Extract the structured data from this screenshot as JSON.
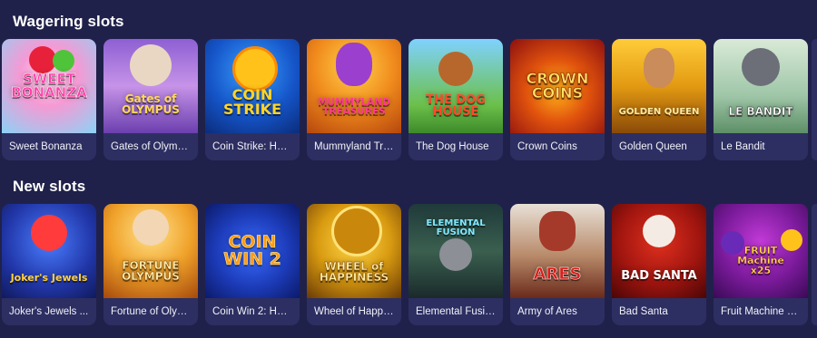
{
  "sections": [
    {
      "title": "Wagering slots",
      "games": [
        {
          "name": "Sweet Bonanza",
          "art": "SWEET\nBONANZA"
        },
        {
          "name": "Gates of Olymp...",
          "art": "Gates of\nOLYMPUS"
        },
        {
          "name": "Coin Strike: Hol...",
          "art": "COIN\nSTRIKE"
        },
        {
          "name": "Mummyland Tre...",
          "art": "MUMMYLAND\nTREASURES"
        },
        {
          "name": "The Dog House",
          "art": "THE DOG\nHOUSE"
        },
        {
          "name": "Crown Coins",
          "art": "CROWN\nCOINS"
        },
        {
          "name": "Golden Queen",
          "art": "GOLDEN QUEEN"
        },
        {
          "name": "Le Bandit",
          "art": "LE BANDIT"
        }
      ]
    },
    {
      "title": "New slots",
      "games": [
        {
          "name": "Joker's Jewels ...",
          "art": "Joker's Jewels"
        },
        {
          "name": "Fortune of Olym...",
          "art": "FORTUNE\nOLYMPUS"
        },
        {
          "name": "Coin Win 2: Hol...",
          "art": "COIN\nWIN 2"
        },
        {
          "name": "Wheel of Happi...",
          "art": "WHEEL of\nHAPPINESS"
        },
        {
          "name": "Elemental Fusion",
          "art": "ELEMENTAL\nFUSION"
        },
        {
          "name": "Army of Ares",
          "art": "ARES"
        },
        {
          "name": "Bad Santa",
          "art": "BAD SANTA"
        },
        {
          "name": "Fruit Machine x...",
          "art": "FRUIT\nMachine\nx25"
        }
      ]
    }
  ],
  "theme": {
    "background": "#20214a",
    "card_background": "#2d2f62",
    "text": "#ffffff"
  }
}
